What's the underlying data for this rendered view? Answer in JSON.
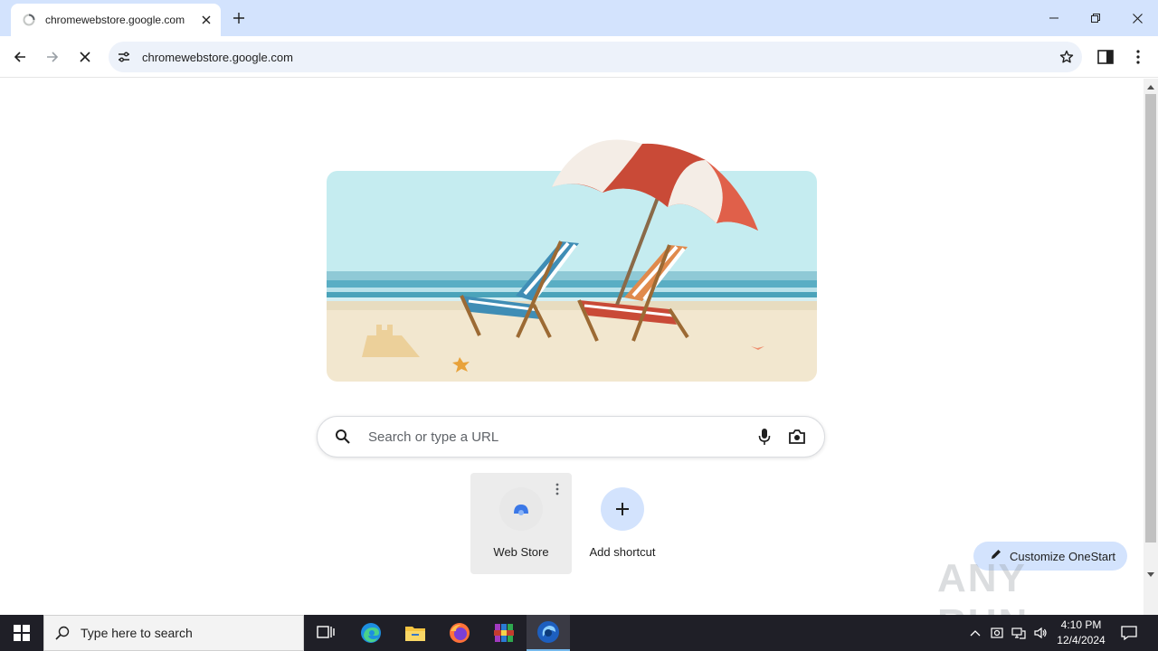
{
  "browser": {
    "tab": {
      "title": "chromewebstore.google.com"
    },
    "omnibox": {
      "url": "chromewebstore.google.com"
    }
  },
  "page": {
    "search": {
      "placeholder": "Search or type a URL"
    },
    "shortcuts": [
      {
        "label": "Web Store"
      },
      {
        "label": "Add shortcut"
      }
    ],
    "customize_label": "Customize OneStart",
    "watermark": "ANY RUN"
  },
  "taskbar": {
    "search_placeholder": "Type here to search",
    "clock": {
      "time": "4:10 PM",
      "date": "12/4/2024"
    }
  },
  "colors": {
    "tabstrip": "#d3e3fd",
    "omnibox": "#edf2fa",
    "taskbar": "#1f1f27",
    "accent": "#1a73e8"
  }
}
